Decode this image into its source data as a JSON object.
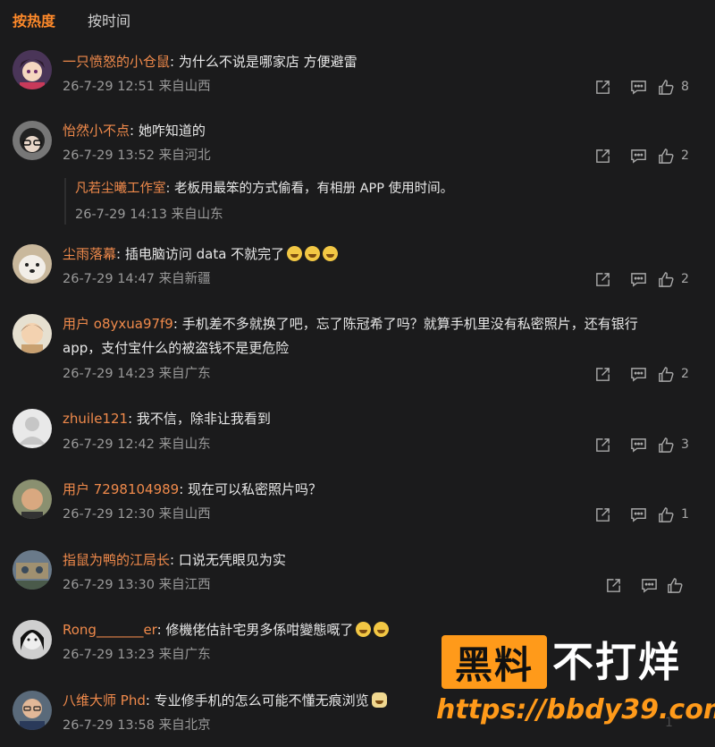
{
  "tabs": {
    "hot": "按热度",
    "time": "按时间"
  },
  "comments": [
    {
      "user": "一只愤怒的小仓鼠",
      "text": "为什么不说是哪家店 方便避雷",
      "time": "26-7-29 12:51",
      "loc": "来自山西",
      "likes": "8"
    },
    {
      "user": "怡然小不点",
      "text": "她咋知道的",
      "time": "26-7-29 13:52",
      "loc": "来自河北",
      "likes": "2",
      "reply": {
        "user": "凡若尘曦工作室",
        "text": "老板用最笨的方式偷看，有相册 APP 使用时间。",
        "time": "26-7-29 14:13",
        "loc": "来自山东"
      }
    },
    {
      "user": "尘雨落幕",
      "text": "插电脑访问 data 不就完了",
      "time": "26-7-29 14:47",
      "loc": "来自新疆",
      "likes": "2"
    },
    {
      "user": "用户 o8yxua97f9",
      "text": "手机差不多就换了吧，忘了陈冠希了吗？就算手机里没有私密照片，还有银行",
      "text2": "app，支付宝什么的被盗钱不是更危险",
      "time": "26-7-29 14:23",
      "loc": "来自广东",
      "likes": "2"
    },
    {
      "user": "zhuile121",
      "text": "我不信，除非让我看到",
      "time": "26-7-29 12:42",
      "loc": "来自山东",
      "likes": "3"
    },
    {
      "user": "用户 7298104989",
      "text": "现在可以私密照片吗？",
      "time": "26-7-29 12:30",
      "loc": "来自山西",
      "likes": "1"
    },
    {
      "user": "指鼠为鸭的江局长",
      "text": "口说无凭眼见为实",
      "time": "26-7-29 13:30",
      "loc": "来自江西",
      "likes": ""
    },
    {
      "user": "Rong_______er",
      "text": "修機佬估計宅男多係咁變態嘅了",
      "time": "26-7-29 13:23",
      "loc": "来自广东",
      "likes": ""
    },
    {
      "user": "八维大师 Phd",
      "text": "专业修手机的怎么可能不懂无痕浏览",
      "time": "26-7-29 13:58",
      "loc": "来自北京",
      "likes": "1"
    }
  ],
  "watermark": {
    "box": "黑料",
    "text": "不打烊",
    "url": "https://bbdy39.com"
  },
  "colors": {
    "accent": "#ff8a2a",
    "username": "#f08a4b",
    "background": "#1b1b1c"
  }
}
